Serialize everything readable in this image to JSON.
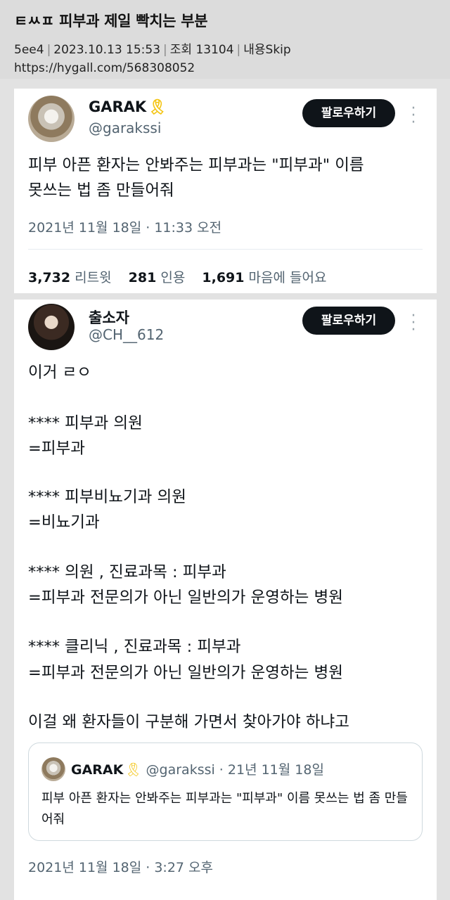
{
  "post": {
    "title": "ㅌㅆㅍ 피부과 제일 빡치는 부분",
    "author": "5ee4",
    "datetime": "2023.10.13 15:53",
    "views": "조회 13104",
    "skip": "내용Skip",
    "url": "https://hygall.com/568308052"
  },
  "tweet1": {
    "name": "GARAK",
    "ribbon": "🎗",
    "handle": "@garakssi",
    "follow_label": "팔로우하기",
    "more_icon": "⋮",
    "text_lines": [
      "피부 아픈 환자는 안봐주는 피부과는 \"피부과\" 이름",
      "못쓰는 법 좀 만들어줘"
    ],
    "timestamp": "2021년 11월 18일 · 11:33 오전",
    "stats": [
      {
        "count": "3,732",
        "label": "리트윗"
      },
      {
        "count": "281",
        "label": "인용"
      },
      {
        "count": "1,691",
        "label": "마음에 들어요"
      }
    ]
  },
  "tweet2": {
    "name": "출소자",
    "handle": "@CH__612",
    "follow_label": "팔로우하기",
    "more_icon": "⋮",
    "lines": [
      "이거 ㄹㅇ",
      "**** 피부과 의원",
      "=피부과",
      "**** 피부비뇨기과 의원",
      "=비뇨기과",
      "**** 의원 , 진료과목 : 피부과",
      "=피부과 전문의가 아닌 일반의가 운영하는 병원",
      "**** 클리닉 , 진료과목 : 피부과",
      "=피부과 전문의가 아닌 일반의가 운영하는 병원",
      "이걸 왜 환자들이 구분해 가면서 찾아가야 하냐고"
    ],
    "quote": {
      "name": "GARAK",
      "ribbon": "🎗",
      "meta": "@garakssi · 21년 11월 18일",
      "text": "피부 아픈 환자는 안봐주는 피부과는 \"피부과\" 이름 못쓰는 법 좀 만들어줘"
    },
    "timestamp": "2021년 11월 18일 · 3:27 오후"
  }
}
